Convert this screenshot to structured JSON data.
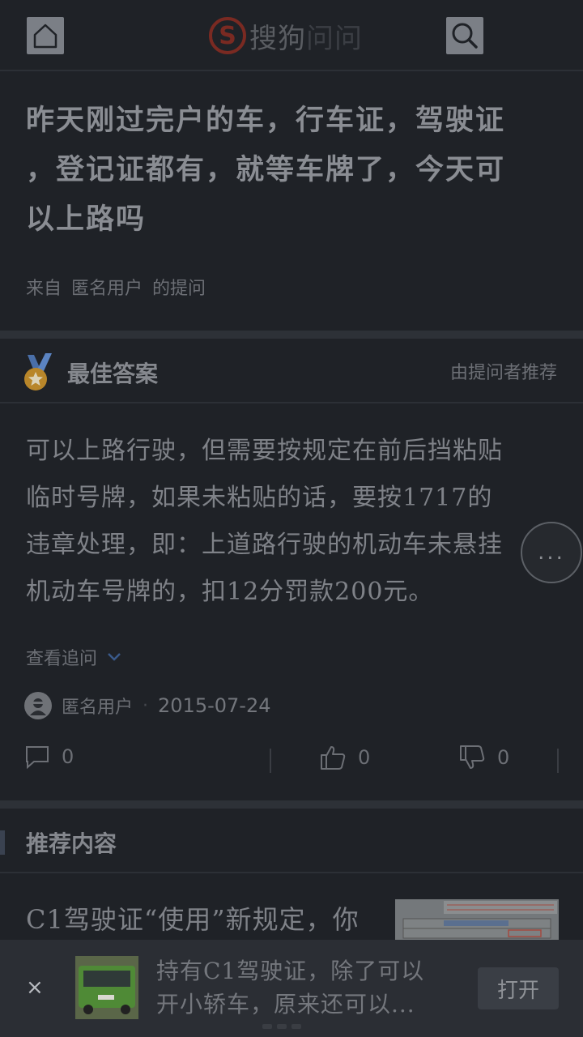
{
  "header": {
    "brand_main": "搜狗",
    "brand_sub": "问问",
    "home_icon": "home-icon",
    "search_icon": "search-icon"
  },
  "question": {
    "lines": [
      "昨天刚过完户的车，行车证，驾驶证",
      "，登记证都有，就等车牌了，今天可",
      "以上路吗"
    ],
    "from": "来自",
    "asker": "匿名用户",
    "suffix": "的提问"
  },
  "best_answer": {
    "title": "最佳答案",
    "note": "由提问者推荐",
    "lines": [
      "可以上路行驶，但需要按规定在前后挡粘贴",
      "临时号牌，如果未粘贴的话，要按1717的",
      "违章处理，即：上道路行驶的机动车未悬挂",
      "机动车号牌的，扣12分罚款200元。"
    ],
    "more": "...",
    "followups": "查看追问",
    "author": "匿名用户",
    "date": "2015-07-24",
    "comments": "0",
    "likes": "0",
    "dislikes": "0"
  },
  "recommended": {
    "title": "推荐内容",
    "item_title": "C1驾驶证“使用”新规定，你"
  },
  "banner": {
    "close": "×",
    "line1": "持有C1驾驶证，除了可以",
    "line2": "开小轿车，原来还可以...",
    "open": "打开"
  },
  "colors": {
    "background": "#1f2227",
    "separator": "#2d3137",
    "logo_red": "#7a2a22",
    "medal_blue": "#4a6fa8",
    "medal_gold": "#b8862a"
  }
}
